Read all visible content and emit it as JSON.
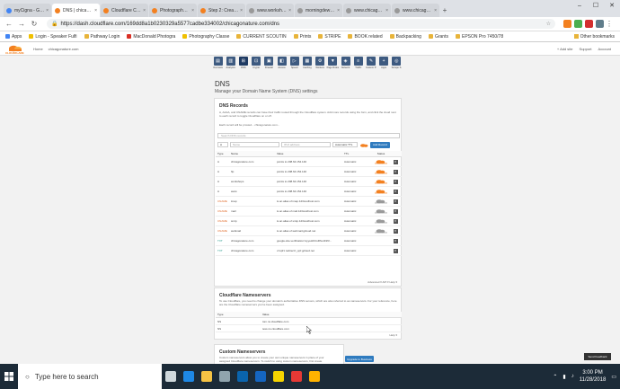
{
  "browser": {
    "tabs": [
      {
        "label": "myCigna - Get A...",
        "fav": "blue"
      },
      {
        "label": "DNS | chicagona...",
        "fav": "orange",
        "active": true
      },
      {
        "label": "Cloudflare Comm...",
        "fav": "orange"
      },
      {
        "label": "Photography Cla...",
        "fav": "orange"
      },
      {
        "label": "Step 2: Create a C...",
        "fav": "orange"
      },
      {
        "label": "www.workshops...",
        "fav": "grey"
      },
      {
        "label": "morningdewpre...",
        "fav": "grey"
      },
      {
        "label": "www.chicagonatur...",
        "fav": "grey"
      },
      {
        "label": "www.chicagonature...",
        "fav": "grey"
      }
    ],
    "url": "https://dash.cloudflare.com/169dd8a1b0230329a5577cadbe334002/chicagonature.com/dns",
    "bookmarks": [
      {
        "label": "Apps",
        "color": "g"
      },
      {
        "label": "Login - Speaker Fulfi",
        "color": "y"
      },
      {
        "label": "Pathway Login",
        "color": ""
      },
      {
        "label": "MacDonald Photogra",
        "color": "r"
      },
      {
        "label": "Photography Classe",
        "color": "y"
      },
      {
        "label": "CURRENT SCOUTIN",
        "color": ""
      },
      {
        "label": "Prints",
        "color": ""
      },
      {
        "label": "STRIPE",
        "color": ""
      },
      {
        "label": "BOOK related",
        "color": ""
      },
      {
        "label": "Backpacking",
        "color": ""
      },
      {
        "label": "Grants",
        "color": ""
      },
      {
        "label": "EPSON Pro 7450/78",
        "color": ""
      }
    ],
    "other_bookmarks": "Other bookmarks",
    "icons": {
      "back": "back-arrow-icon",
      "forward": "forward-arrow-icon",
      "reload": "reload-icon",
      "lock": "lock-icon",
      "star": "bookmark-star-icon"
    }
  },
  "cloudflare": {
    "logo_text": "CLOUDFLARE",
    "crumbs": [
      "Home",
      "chicagonature.com"
    ],
    "right_links": [
      "+ Add site",
      "Support",
      "Account"
    ],
    "apps": [
      {
        "label": "Overview",
        "glyph": "▤"
      },
      {
        "label": "Analytics",
        "glyph": "▥"
      },
      {
        "label": "DNS",
        "glyph": "⊞",
        "active": true
      },
      {
        "label": "Crypto",
        "glyph": "⊡"
      },
      {
        "label": "Firewall",
        "glyph": "▣"
      },
      {
        "label": "Access",
        "glyph": "◧"
      },
      {
        "label": "Speed",
        "glyph": "▷"
      },
      {
        "label": "Caching",
        "glyph": "▦"
      },
      {
        "label": "Workers",
        "glyph": "⚙"
      },
      {
        "label": "Page Rules",
        "glyph": "▼"
      },
      {
        "label": "Network",
        "glyph": "◈"
      },
      {
        "label": "Traffic",
        "glyph": "≡"
      },
      {
        "label": "Custom P.",
        "glyph": "✎"
      },
      {
        "label": "Apps",
        "glyph": "+"
      },
      {
        "label": "Scrape S.",
        "glyph": "◎"
      }
    ],
    "page_title": "DNS",
    "page_subtitle": "Manage your Domain Name System (DNS) settings",
    "dns_records": {
      "heading": "DNS Records",
      "description": "A, AAAA, and CNAME records can have their traffic routed through the Cloudflare system. Add more records using the form, and click the cloud next to each record to toggle Cloudflare on or off.",
      "warning": "Each record will be proxied... chicagonature.com...",
      "search_placeholder": "Search DNS records",
      "add_form": {
        "type": "A",
        "name": "Name",
        "value": "IPv4 address",
        "ttl": "Automatic TTL",
        "button": "Add Record"
      },
      "columns": [
        "Type",
        "Name",
        "Value",
        "TTL",
        "Status"
      ],
      "rows": [
        {
          "type": "A",
          "name": "chicagonature.com",
          "value": "points to 208.64.154.140",
          "ttl": "Automatic",
          "proxied": true
        },
        {
          "type": "A",
          "name": "ftp",
          "value": "points to 208.64.154.140",
          "ttl": "Automatic",
          "proxied": true
        },
        {
          "type": "A",
          "name": "workshops",
          "value": "points to 208.64.154.140",
          "ttl": "Automatic",
          "proxied": true
        },
        {
          "type": "A",
          "name": "www",
          "value": "points to 208.64.154.140",
          "ttl": "Automatic",
          "proxied": true
        },
        {
          "type": "CNAME",
          "name": "imap",
          "value": "is an alias of imap.123coolhost.com",
          "ttl": "Automatic",
          "proxied": false
        },
        {
          "type": "CNAME",
          "name": "mail",
          "value": "is an alias of mail.123coolhost.com",
          "ttl": "Automatic",
          "proxied": false
        },
        {
          "type": "CNAME",
          "name": "smtp",
          "value": "is an alias of smtp.123coolhost.com",
          "ttl": "Automatic",
          "proxied": false
        },
        {
          "type": "CNAME",
          "name": "webmail",
          "value": "is an alias of webmail.gcloud.net",
          "ttl": "Automatic",
          "proxied": false
        },
        {
          "type": "TXT",
          "name": "chicagonature.com",
          "value": "google-site-verification=syyeHKCsRhu1FlrR...",
          "ttl": "Automatic",
          "proxied": null
        },
        {
          "type": "TXT",
          "name": "chicagonature.com",
          "value": "v=spf1 redirect=_spf.gcloud.net",
          "ttl": "Automatic",
          "proxied": null
        }
      ],
      "pagination": "Advanced ▾    API ▾    Help ▾"
    },
    "nameservers": {
      "heading": "Cloudflare Nameservers",
      "description": "To use Cloudflare, you need to change your domain's authoritative DNS servers, which are also referred to as nameservers. For your reference, here are the Cloudflare nameservers you've been assigned.",
      "columns": [
        "Type",
        "Value"
      ],
      "rows": [
        {
          "type": "NS",
          "value": "tom.ns.cloudflare.com"
        },
        {
          "type": "NS",
          "value": "tess.ns.cloudflare.com"
        }
      ],
      "footer": "Help ▾"
    },
    "custom_ns": {
      "heading": "Custom Nameservers",
      "description": "Custom nameservers allow you to create your own unique nameservers in place of your assigned Cloudflare nameservers. To switch to using custom nameservers, first create them here and then set them as your nameservers.",
      "button": "Upgrade to Business"
    },
    "feedback": "Send Feedback"
  },
  "taskbar": {
    "search_placeholder": "Type here to search",
    "time": "3:00 PM",
    "date": "11/28/2018",
    "apps": [
      {
        "name": "task-view-icon",
        "color": "#cfd8dc"
      },
      {
        "name": "edge-icon",
        "color": "#1e88e5"
      },
      {
        "name": "file-explorer-icon",
        "color": "#f6c344"
      },
      {
        "name": "store-icon",
        "color": "#90a4ae"
      },
      {
        "name": "outlook-icon",
        "color": "#0a64ad"
      },
      {
        "name": "mail-icon",
        "color": "#1565c0"
      },
      {
        "name": "sticky-notes-icon",
        "color": "#f6d400"
      },
      {
        "name": "chrome-icon",
        "color": "#e53935"
      },
      {
        "name": "files-icon",
        "color": "#ffb300"
      }
    ]
  }
}
